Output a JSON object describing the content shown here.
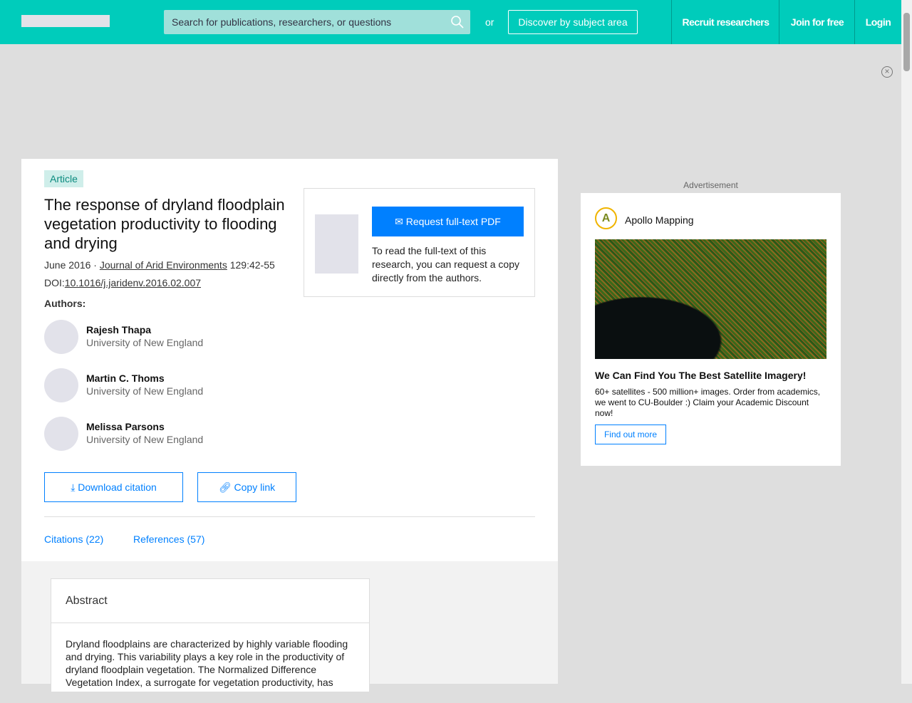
{
  "header": {
    "search_placeholder": "Search for publications, researchers, or questions",
    "or": "or",
    "discover": "Discover by subject area",
    "recruit": "Recruit researchers",
    "join": "Join for free",
    "login": "Login"
  },
  "article": {
    "type": "Article",
    "title": "The response of dryland floodplain vegetation productivity to flooding and drying",
    "date": "June 2016 · ",
    "journal": "Journal of Arid Environments",
    "pages": " 129:42-55",
    "doi_label": "DOI:",
    "doi": "10.1016/j.jaridenv.2016.02.007",
    "authors_label": "Authors:",
    "authors": [
      {
        "name": "Rajesh Thapa",
        "affiliation": "University of New England"
      },
      {
        "name": "Martin C. Thoms",
        "affiliation": "University of New England"
      },
      {
        "name": "Melissa Parsons",
        "affiliation": "University of New England"
      }
    ],
    "download_citation": "Download citation",
    "copy_link": "Copy link",
    "tabs": [
      "Citations (22)",
      "References (57)"
    ],
    "request_button": "Request full-text PDF",
    "request_text": "To read the full-text of this research, you can request a copy directly from the authors."
  },
  "abstract": {
    "heading": "Abstract",
    "text": "Dryland floodplains are characterized by highly variable flooding and drying. This variability plays a key role in the productivity of dryland floodplain vegetation. The Normalized Difference Vegetation Index, a surrogate for vegetation productivity, has"
  },
  "ad": {
    "label": "Advertisement",
    "advertiser": "Apollo Mapping",
    "headline": "We Can Find You The Best Satellite Imagery!",
    "body": "60+ satellites - 500 million+ images. Order from academics, we went to CU-Boulder :) Claim your Academic Discount now!",
    "cta": "Find out more"
  },
  "colors": {
    "brand": "#00ccbb",
    "accent": "#0080ff"
  }
}
